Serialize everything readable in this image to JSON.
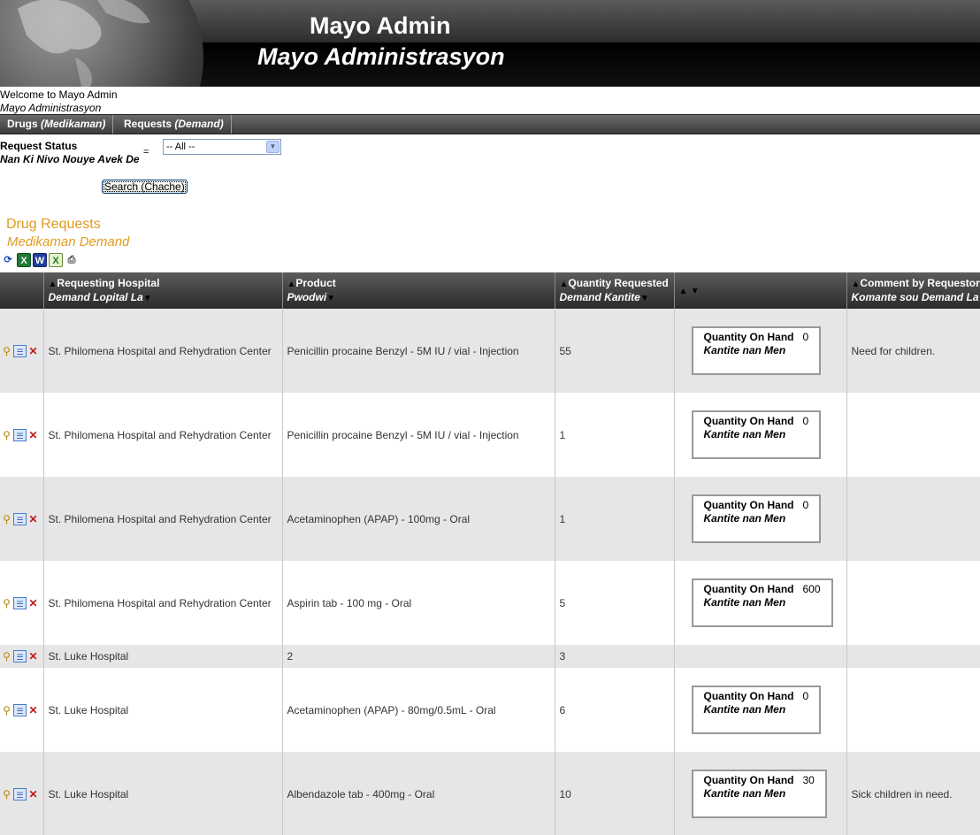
{
  "header": {
    "title": "Mayo Admin",
    "subtitle": "Mayo Administrasyon"
  },
  "welcome": {
    "line1": "Welcome to Mayo Admin",
    "line2": "Mayo Administrasyon"
  },
  "nav": {
    "drugs": "Drugs",
    "drugs_sub": "(Medikaman)",
    "requests": "Requests",
    "requests_sub": "(Demand)"
  },
  "filter": {
    "label": "Request Status",
    "label_sub": "Nan Ki Nivo Nouye Avek De",
    "operator": "=",
    "selected": "-- All --",
    "search_button": "Search (Chache)"
  },
  "section": {
    "title": "Drug Requests",
    "title_sub": "Medikaman Demand"
  },
  "export_icons": [
    "refresh-icon",
    "excel-icon",
    "word-icon",
    "xml-icon",
    "print-icon"
  ],
  "columns": {
    "hospital": "Requesting Hospital",
    "hospital_sub": "Demand Lopital La",
    "product": "Product",
    "product_sub": "Pwodwi",
    "qty": "Quantity Requested",
    "qty_sub": "Demand Kantite",
    "comment": "Comment by Requestor",
    "comment_sub": "Komante sou Demand La"
  },
  "onhand": {
    "label": "Quantity On Hand",
    "label_sub": "Kantite nan Men"
  },
  "rows": [
    {
      "hospital": "St. Philomena Hospital and Rehydration Center",
      "product": "Penicillin procaine Benzyl - 5M IU / vial - Injection",
      "qty": "55",
      "onhand": "0",
      "comment": "Need for children."
    },
    {
      "hospital": "St. Philomena Hospital and Rehydration Center",
      "product": "Penicillin procaine Benzyl - 5M IU / vial - Injection",
      "qty": "1",
      "onhand": "0",
      "comment": ""
    },
    {
      "hospital": "St. Philomena Hospital and Rehydration Center",
      "product": "Acetaminophen (APAP) - 100mg - Oral",
      "qty": "1",
      "onhand": "0",
      "comment": ""
    },
    {
      "hospital": "St. Philomena Hospital and Rehydration Center",
      "product": "Aspirin tab - 100 mg - Oral",
      "qty": "5",
      "onhand": "600",
      "comment": ""
    },
    {
      "hospital": "St. Luke Hospital",
      "product": "2",
      "qty": "3",
      "onhand": null,
      "comment": ""
    },
    {
      "hospital": "St. Luke Hospital",
      "product": "Acetaminophen (APAP) - 80mg/0.5mL - Oral",
      "qty": "6",
      "onhand": "0",
      "comment": ""
    },
    {
      "hospital": "St. Luke Hospital",
      "product": "Albendazole tab - 400mg - Oral",
      "qty": "10",
      "onhand": "30",
      "comment": "Sick children in need."
    }
  ]
}
